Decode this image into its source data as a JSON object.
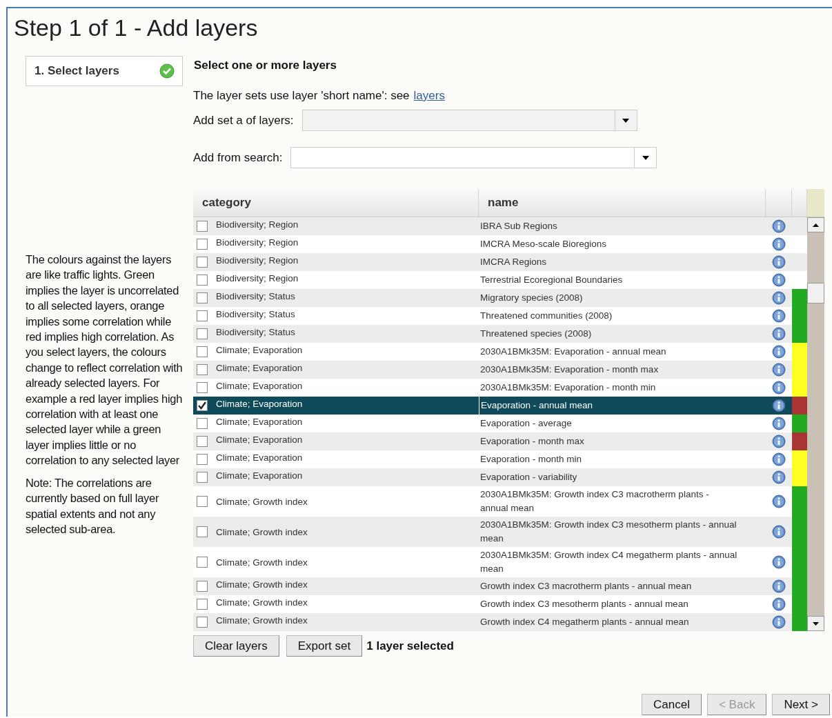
{
  "title": "Step 1 of 1 - Add layers",
  "steps": [
    {
      "label": "1. Select layers",
      "complete": true
    }
  ],
  "help": [
    "The colours against the layers are like traffic lights. Green implies the layer is uncorrelated to all selected layers, orange implies some correlation while red implies high correlation. As you select layers, the colours change to reflect correlation with already selected layers. For example a red layer implies high correlation with at least one selected layer while a green layer implies little or no correlation to any selected layer",
    "Note: The correlations are currently based on full layer spatial extents and not any selected sub-area."
  ],
  "heading": "Select one or more layers",
  "intro": {
    "text": "The layer sets use layer 'short name': see",
    "link": "layers"
  },
  "fields": [
    {
      "label": "Add set a of layers:",
      "disabled": true
    },
    {
      "label": "Add from search:",
      "disabled": false
    }
  ],
  "table": {
    "columns": [
      "category",
      "name"
    ],
    "rows": [
      {
        "category": "Biodiversity; Region",
        "name": "IBRA Sub Regions",
        "checked": false,
        "selected": false
      },
      {
        "category": "Biodiversity; Region",
        "name": "IMCRA Meso-scale Bioregions",
        "checked": false,
        "selected": false
      },
      {
        "category": "Biodiversity; Region",
        "name": "IMCRA Regions",
        "checked": false,
        "selected": false
      },
      {
        "category": "Biodiversity; Region",
        "name": "Terrestrial Ecoregional Boundaries",
        "checked": false,
        "selected": false
      },
      {
        "category": "Biodiversity; Status",
        "name": "Migratory species (2008)",
        "checked": false,
        "selected": false,
        "color": "#22aa22"
      },
      {
        "category": "Biodiversity; Status",
        "name": "Threatened communities (2008)",
        "checked": false,
        "selected": false,
        "color": "#22aa22"
      },
      {
        "category": "Biodiversity; Status",
        "name": "Threatened species (2008)",
        "checked": false,
        "selected": false,
        "color": "#22aa22"
      },
      {
        "category": "Climate; Evaporation",
        "name": "2030A1BMk35M: Evaporation - annual mean",
        "checked": false,
        "selected": false,
        "color": "#ffff22"
      },
      {
        "category": "Climate; Evaporation",
        "name": "2030A1BMk35M: Evaporation - month max",
        "checked": false,
        "selected": false,
        "color": "#ffff22"
      },
      {
        "category": "Climate; Evaporation",
        "name": "2030A1BMk35M: Evaporation - month min",
        "checked": false,
        "selected": false,
        "color": "#ffff22"
      },
      {
        "category": "Climate; Evaporation",
        "name": "Evaporation - annual mean",
        "checked": true,
        "selected": true,
        "color": "#aa3333"
      },
      {
        "category": "Climate; Evaporation",
        "name": "Evaporation - average",
        "checked": false,
        "selected": false,
        "color": "#22aa22"
      },
      {
        "category": "Climate; Evaporation",
        "name": "Evaporation - month max",
        "checked": false,
        "selected": false,
        "color": "#aa3333"
      },
      {
        "category": "Climate; Evaporation",
        "name": "Evaporation - month min",
        "checked": false,
        "selected": false,
        "color": "#ffff22"
      },
      {
        "category": "Climate; Evaporation",
        "name": "Evaporation - variability",
        "checked": false,
        "selected": false,
        "color": "#ffff22"
      },
      {
        "category": "Climate; Growth index",
        "name": "2030A1BMk35M: Growth index C3 macrotherm plants - annual mean",
        "checked": false,
        "selected": false,
        "color": "#22aa22"
      },
      {
        "category": "Climate; Growth index",
        "name": "2030A1BMk35M: Growth index C3 mesotherm plants - annual mean",
        "checked": false,
        "selected": false,
        "color": "#22aa22"
      },
      {
        "category": "Climate; Growth index",
        "name": "2030A1BMk35M: Growth index C4 megatherm plants - annual mean",
        "checked": false,
        "selected": false,
        "color": "#22aa22"
      },
      {
        "category": "Climate; Growth index",
        "name": "Growth index C3 macrotherm plants - annual mean",
        "checked": false,
        "selected": false,
        "color": "#22aa22"
      },
      {
        "category": "Climate; Growth index",
        "name": "Growth index C3 mesotherm plants - annual mean",
        "checked": false,
        "selected": false,
        "color": "#22aa22"
      },
      {
        "category": "Climate; Growth index",
        "name": "Growth index C4 megatherm plants - annual mean",
        "checked": false,
        "selected": false,
        "color": "#22aa22"
      }
    ]
  },
  "actions": [
    "Clear layers",
    "Export set"
  ],
  "selection_count": "1 layer selected",
  "nav": [
    {
      "label": "Cancel",
      "disabled": false
    },
    {
      "label": "< Back",
      "disabled": true
    },
    {
      "label": "Next >",
      "disabled": false
    }
  ]
}
